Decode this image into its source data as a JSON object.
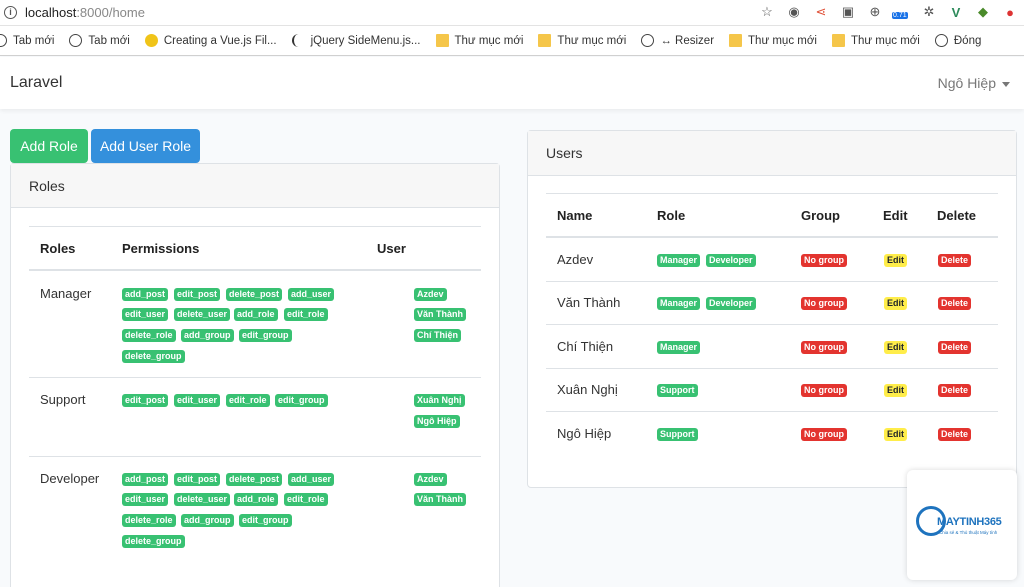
{
  "browser": {
    "url_host": "localhost",
    "url_path": ":8000/home",
    "bookmarks": [
      "Tab mới",
      "Tab mới",
      "Creating a Vue.js Fil...",
      "jQuery SideMenu.js...",
      "Thư mục mới",
      "Thư mục mới",
      "↔ Resizer",
      "Thư mục mới",
      "Thư mục mới",
      "Đóng"
    ],
    "ext_badge": "0.71"
  },
  "navbar": {
    "brand": "Laravel",
    "user": "Ngô Hiệp"
  },
  "actions": {
    "add_role": "Add Role",
    "add_user_role": "Add User Role"
  },
  "roles_card": {
    "title": "Roles",
    "headers": [
      "Roles",
      "Permissions",
      "User"
    ],
    "rows": [
      {
        "role": "Manager",
        "permissions": [
          "add_post",
          "edit_post",
          "delete_post",
          "add_user",
          "edit_user",
          "delete_user",
          "add_role",
          "edit_role",
          "delete_role",
          "add_group",
          "edit_group",
          "delete_group"
        ],
        "users": [
          "Azdev",
          "Văn Thành",
          "Chí Thiện"
        ]
      },
      {
        "role": "Support",
        "permissions": [
          "edit_post",
          "edit_user",
          "edit_role",
          "edit_group"
        ],
        "users": [
          "Xuân Nghị",
          "Ngô Hiệp"
        ]
      },
      {
        "role": "Developer",
        "permissions": [
          "add_post",
          "edit_post",
          "delete_post",
          "add_user",
          "edit_user",
          "delete_user",
          "add_role",
          "edit_role",
          "delete_role",
          "add_group",
          "edit_group",
          "delete_group"
        ],
        "users": [
          "Azdev",
          "Văn Thành"
        ]
      }
    ]
  },
  "users_card": {
    "title": "Users",
    "headers": [
      "Name",
      "Role",
      "Group",
      "Edit",
      "Delete"
    ],
    "rows": [
      {
        "name": "Azdev",
        "roles": [
          "Manager",
          "Developer"
        ],
        "group": "No group",
        "edit": "Edit",
        "delete": "Delete"
      },
      {
        "name": "Văn Thành",
        "roles": [
          "Manager",
          "Developer"
        ],
        "group": "No group",
        "edit": "Edit",
        "delete": "Delete"
      },
      {
        "name": "Chí Thiện",
        "roles": [
          "Manager"
        ],
        "group": "No group",
        "edit": "Edit",
        "delete": "Delete"
      },
      {
        "name": "Xuân Nghị",
        "roles": [
          "Support"
        ],
        "group": "No group",
        "edit": "Edit",
        "delete": "Delete"
      },
      {
        "name": "Ngô Hiệp",
        "roles": [
          "Support"
        ],
        "group": "No group",
        "edit": "Edit",
        "delete": "Delete"
      }
    ]
  },
  "watermark": {
    "brand": "MAYTINH365",
    "tagline": "Chia sẻ & Thủ thuật Máy tính"
  },
  "colors": {
    "success": "#38c172",
    "primary": "#3490dc",
    "danger": "#e3342f",
    "warning": "#ffed4a"
  }
}
